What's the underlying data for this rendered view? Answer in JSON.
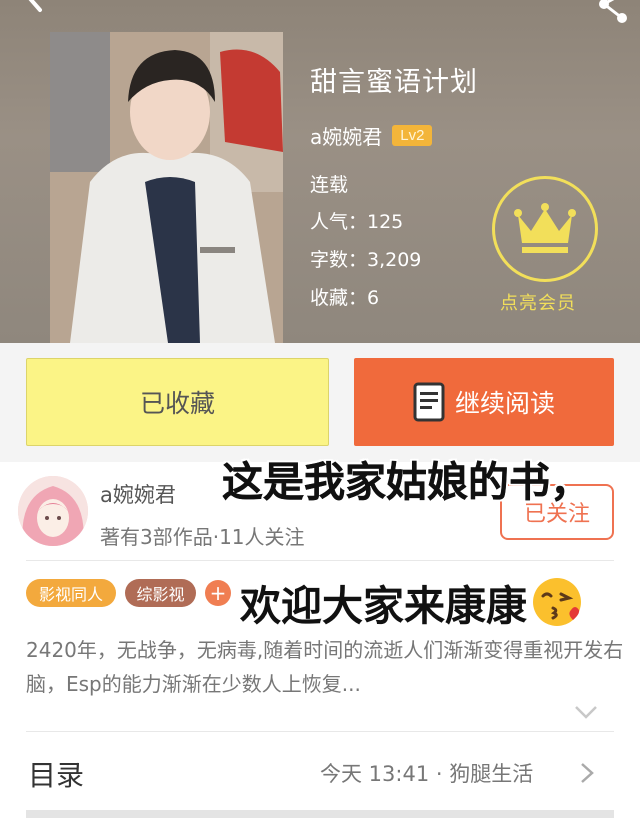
{
  "book": {
    "title": "甜言蜜语计划",
    "author": "a婉婉君",
    "level": "Lv2",
    "status": "连载",
    "popularity": "人气：125",
    "word_count": "字数：3,209",
    "collections": "收藏：6"
  },
  "vip": {
    "label": "点亮会员",
    "color": "#f2df5a"
  },
  "actions": {
    "favorited_label": "已收藏",
    "continue_label": "继续阅读"
  },
  "author_card": {
    "name": "a婉婉君",
    "stats": "著有3部作品·11人关注",
    "follow_label": "已关注"
  },
  "overlay_text": {
    "line1": "这是我家姑娘的书，",
    "line2": "欢迎大家来康康"
  },
  "tags": [
    "影视同人",
    "综影视"
  ],
  "tag_add": "+",
  "intro": "2420年，无战争，无病毒,随着时间的流逝人们渐渐变得重视开发右脑，Esp的能力渐渐在少数人上恢复...",
  "toc": {
    "label": "目录",
    "update": "今天 13:41 · 狗腿生活"
  },
  "icons": {
    "back": "back-arrow-icon",
    "share": "share-icon",
    "crown": "crown-icon",
    "book": "book-icon",
    "expand": "chevron-down-icon",
    "toc_arrow": "chevron-right-icon",
    "emoji": "kissing-face-emoji"
  },
  "colors": {
    "accent_orange": "#f06a3c",
    "fav_yellow": "#fbf486",
    "badge": "#f3b53a"
  }
}
